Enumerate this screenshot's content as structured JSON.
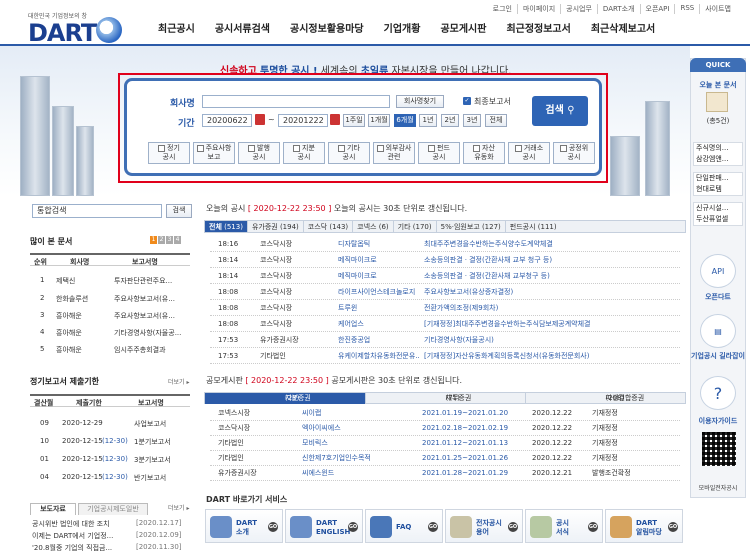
{
  "header": {
    "logo_sub": "대한민국 기업정보의 창",
    "logo": "DART",
    "topnav": [
      "로그인",
      "마이페이지",
      "공시업무",
      "DART소개",
      "오픈API",
      "RSS",
      "사이트맵"
    ],
    "menu": [
      "최근공시",
      "공시서류검색",
      "공시정보활용마당",
      "기업개황",
      "공모게시판",
      "최근정정보고서",
      "최근삭제보고서"
    ]
  },
  "hero": {
    "slogan_1": "신속하고",
    "slogan_2": "투명한 공시 !",
    "slogan_3": "세계속의",
    "slogan_4": "초일류",
    "slogan_5": "자본시장을 만들어 나갑니다."
  },
  "search": {
    "company_label": "회사명",
    "company_value": "",
    "find_btn": "회사명찾기",
    "final_label": "최종보고서",
    "period_label": "기간",
    "date_from": "20200622",
    "date_to": "20201222",
    "tilde": "~",
    "periods": [
      "1주일",
      "1개월",
      "6개월",
      "1년",
      "2년",
      "3년",
      "전체"
    ],
    "active_period": "6개월",
    "submit": "검색",
    "cats": [
      [
        "정기",
        "공시"
      ],
      [
        "주요사항",
        "보고"
      ],
      [
        "발행",
        "공시"
      ],
      [
        "지분",
        "공시"
      ],
      [
        "기타",
        "공시"
      ],
      [
        "외부감사",
        "관련"
      ],
      [
        "펀드",
        "공시"
      ],
      [
        "자산",
        "유동화"
      ],
      [
        "거래소",
        "공시"
      ],
      [
        "공정위",
        "공시"
      ]
    ]
  },
  "quick": {
    "title": "QUICK",
    "today_title": "오늘 본 문서",
    "count": "(총5건)",
    "cards": [
      "주식명의...",
      "삼강엠앤...",
      "단일판매...",
      "현대로템",
      "신규시설...",
      "두산퓨얼셀"
    ],
    "icons": [
      {
        "label": "오픈다트",
        "icon": "API"
      },
      {
        "label": "기업공시 길라잡이",
        "icon": "doc-icon"
      },
      {
        "label": "이용자가이드",
        "icon": "?"
      },
      {
        "label": "모바일전자공시",
        "icon": "qr-icon"
      }
    ]
  },
  "left": {
    "keyword_label": "통합검색",
    "search_btn": "검색",
    "most_viewed": "많이 본 문서",
    "pages": [
      "1",
      "2",
      "3",
      "4"
    ],
    "mv_headers": [
      "순위",
      "회사명",
      "보고서명"
    ],
    "mv_rows": [
      [
        "1",
        "제택신",
        "투자판단관련주요..."
      ],
      [
        "2",
        "한화솔루션",
        "주요사항보고서(유..."
      ],
      [
        "3",
        "흥아해운",
        "주요사항보고서(유..."
      ],
      [
        "4",
        "흥아해운",
        "기타경영사항(자율공..."
      ],
      [
        "5",
        "흥아해운",
        "임시주주총회결과"
      ]
    ],
    "regular_title": "정기보고서 제출기한",
    "more": "더보기 ▸",
    "reg_headers": [
      "결산월",
      "제출기한",
      "보고서명"
    ],
    "reg_rows": [
      [
        "09",
        "2020-12-29",
        "",
        "사업보고서"
      ],
      [
        "10",
        "2020-12-15",
        "(12-30)",
        "1분기보고서"
      ],
      [
        "01",
        "2020-12-15",
        "(12-30)",
        "3분기보고서"
      ],
      [
        "04",
        "2020-12-15",
        "(12-30)",
        "반기보고서"
      ]
    ],
    "tab_a": "보도자료",
    "tab_b": "기업공시제도일반",
    "news": [
      [
        "공시위반 법인에 대한 조치",
        "[2020.12.17]"
      ],
      [
        "이제는 DART에서 기업정...",
        "[2020.12.09]"
      ],
      [
        "'20.8월중 기업의 직접금...",
        "[2020.11.30]"
      ]
    ]
  },
  "today": {
    "label": "오늘의 공시",
    "time": "[ 2020-12-22 23:50 ]",
    "suffix": "오늘의 공시는 30초 단위로 갱신됩니다.",
    "tabs": [
      [
        "전체",
        "(513)"
      ],
      [
        "유가증권",
        "(194)"
      ],
      [
        "코스닥",
        "(143)"
      ],
      [
        "코넥스",
        "(6)"
      ],
      [
        "기타",
        "(170)"
      ],
      [
        "5%·임원보고",
        "(127)"
      ],
      [
        "펀드공시",
        "(111)"
      ]
    ],
    "rows": [
      [
        "18:16",
        "코스닥시장",
        "디자탈옵틱",
        "최대주주변경을수반하는주식양수도계약체결"
      ],
      [
        "18:14",
        "코스닥시장",
        "메직마이크로",
        "소송등의판결ㆍ결정(간환사채 교부 청구 등)"
      ],
      [
        "18:14",
        "코스닥시장",
        "메직마이크로",
        "소송등의판결ㆍ결정(간환사채 교부청구 등)"
      ],
      [
        "18:08",
        "코스닥시장",
        "라이프사이언스테크놀로지",
        "주요사항보고서(유상증자결정)"
      ],
      [
        "18:08",
        "코스닥시장",
        "트루윈",
        "전환가액의조정(제9회차)"
      ],
      [
        "18:08",
        "코스닥시장",
        "케어업스",
        "[기재정정]최대주주변경을수반하는주식담보제공계약체결"
      ],
      [
        "17:53",
        "유가증권시장",
        "한진중공업",
        "기타경영사항(자율공시)"
      ],
      [
        "17:53",
        "기타법인",
        "유케이제할차유동화전문유...",
        "[기재정정]자산유동화계획의등록신청서(유동화전문회사)"
      ]
    ]
  },
  "ipo": {
    "label": "공모게시판",
    "time": "[ 2020-12-22 23:50 ]",
    "suffix": "공모게시판은 30초 단위로 갱신됩니다.",
    "h_company": "지분증권",
    "h_company_n": "(28)",
    "h_debt": "채무증권",
    "h_debt_n": "(71)",
    "h_deriv": "파생결합증권",
    "h_deriv_n": "(208)",
    "rows": [
      [
        "코넥스시장",
        "씨이랩",
        "2021.01.19~2021.01.20",
        "2020.12.22",
        "기재정정"
      ],
      [
        "코스닥시장",
        "엑아이씨에스",
        "2021.02.18~2021.02.19",
        "2020.12.22",
        "기재정정"
      ],
      [
        "기타법인",
        "모비릭스",
        "2021.01.12~2021.01.13",
        "2020.12.22",
        "기재정정"
      ],
      [
        "기타법인",
        "신한제7호기업인수목적",
        "2021.01.25~2021.01.26",
        "2020.12.22",
        "기재정정"
      ],
      [
        "유가증권시장",
        "씨에스윈드",
        "2021.01.28~2021.01.29",
        "2020.12.21",
        "발행조건확정"
      ]
    ]
  },
  "services": {
    "title": "DART 바로가기 서비스",
    "items": [
      [
        "DART",
        "소개"
      ],
      [
        "DART",
        "ENGLISH"
      ],
      [
        "FAQ",
        ""
      ],
      [
        "전자공시",
        "용어"
      ],
      [
        "공시",
        "서식"
      ],
      [
        "DART",
        "알림마당"
      ]
    ]
  }
}
